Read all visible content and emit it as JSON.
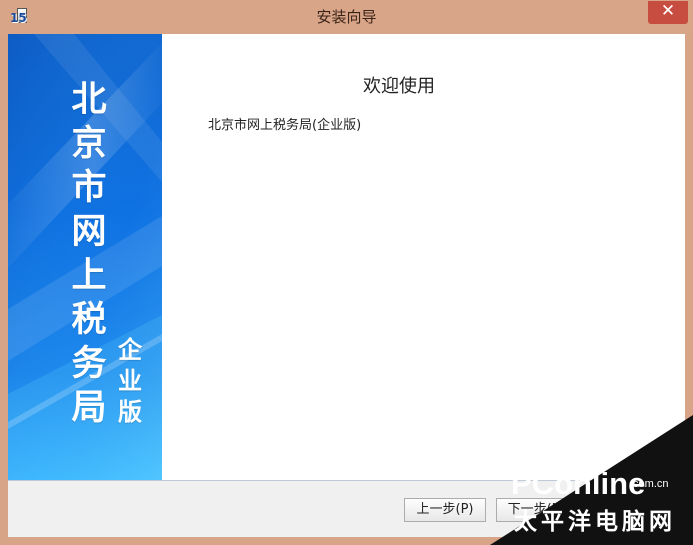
{
  "window": {
    "title": "安装向导",
    "icon_text": "15",
    "close_label": "✕",
    "app_icon": "installer-icon",
    "close_icon": "close-icon"
  },
  "banner": {
    "main_title": "北京市网上税务局",
    "sub_title": "企业版"
  },
  "welcome": {
    "title": "欢迎使用",
    "subtitle": "北京市网上税务局(企业版)"
  },
  "footer": {
    "previous_label": "上一步(P)",
    "next_label": "下一步(N)"
  },
  "watermark": {
    "brand": "PConline",
    "domain": ".com.cn",
    "site_name": "太平洋电脑网"
  },
  "colors": {
    "titlebar": "#d9a588",
    "close_button": "#c64d3f",
    "banner_top": "#0f5fc9",
    "banner_bottom": "#3ab4ff",
    "panel": "#ffffff",
    "footer": "#f0f0f0",
    "watermark_dark": "#111111"
  }
}
